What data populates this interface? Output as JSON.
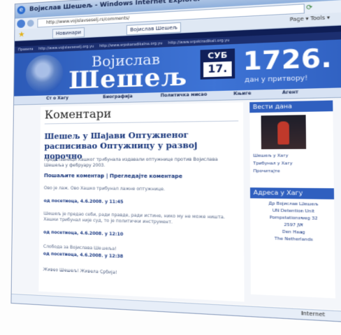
{
  "browser": {
    "title": "Војислав Шешељ - Windows Internet Explorer",
    "address": "http://www.vojislavseselj.rs/comments/",
    "tab_primary": "Новинари",
    "tab_secondary": "Војислав Шешељ",
    "tools": "Page ▾  Tools ▾",
    "status": "Internet"
  },
  "site": {
    "top_links": [
      "Правила",
      "http://www.vojislavseselj.org.yu",
      "http://www.srpskaradikalna.org.yu",
      "http://www.srpskiradikali.org.yu"
    ],
    "first_name": "Војислав",
    "last_name": "Шешељ",
    "day_label": "СУБ",
    "day_number": "17.",
    "counter": "1726.",
    "counter_sub": "дан у притвору!",
    "menu": [
      "Ст о Хагу",
      "Биографија",
      "Политичка мисао",
      "Књиге",
      "Агент"
    ]
  },
  "main": {
    "heading": "Коментари",
    "article_title": "Шешељ у Шајави Оптужненог расписивао Оптужницу у развој порочно",
    "lead": "Представници Хашког трибунала издавали оптужнице против Војислава Шешеља у фебруару 2003.",
    "subheading": "Пошаљите коментар | Прегледајте коментаре",
    "comments": [
      {
        "text": "Ово је лаж. Ово Хашко трибунал лажне оптужнице.",
        "meta": "од посетиоца, 4.6.2008. у 11:45"
      },
      {
        "text": "Шешељ је предао себи, ради правде, ради истине, нико му не може ништа. Хашки трибунал није суд, то је политички инструмент.",
        "meta": "од посетиоца, 4.6.2008. у 12:10"
      },
      {
        "text": "Слобода за Војислава Шешеља!",
        "meta": "од посетиоца, 4.6.2008. у 12:38"
      },
      {
        "text": "Живео Шешељ! Живела Србија!",
        "meta": ""
      }
    ]
  },
  "sidebar": {
    "panel1_title": "Вести дана",
    "panel1_links": [
      "Шешељ у Хагу",
      "Трибунал у Хагу",
      "Прочитајте"
    ],
    "panel2_title": "Адреса у Хагу",
    "address_lines": [
      "Др Војислав Шешељ",
      "UN Detention Unit",
      "Pompstationsweg 32",
      "2597 JW",
      "Den Haag",
      "The Netherlands"
    ]
  }
}
